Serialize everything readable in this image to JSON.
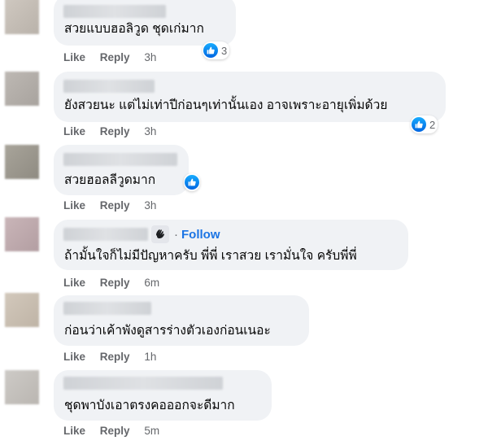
{
  "actions": {
    "like": "Like",
    "reply": "Reply"
  },
  "colors": {
    "bubble": "#f0f2f5",
    "link": "#1b74e4",
    "muted": "#65676b",
    "like_blue": "#0866ff"
  },
  "comments": [
    {
      "text": "สวยแบบฮอลิวูด ชุดเก่มาก",
      "time": "3h",
      "reactions": "3"
    },
    {
      "text": "ยังสวยนะ แต่ไม่เท่าปีก่อนๆเท่านั้นเอง อาจเพราะอายุเพิ่มด้วย",
      "time": "3h",
      "reactions": "2"
    },
    {
      "text": "สวยฮอลลีวูดมาก",
      "time": "3h",
      "reactions": ""
    },
    {
      "text": "ถ้ามั้นใจก็ไม่มีปัญหาครับ พี่พี่ เราสวย เรามั่นใจ ครับพี่พี่",
      "time": "6m",
      "follow": "Follow"
    },
    {
      "text": "ก่อนว่าเค้าพังดูสารร่างตัวเองก่อนเนอะ",
      "time": "1h"
    },
    {
      "text": "ชุดพาบังเอาตรงคอออกจะดีมาก",
      "time": "5m"
    }
  ]
}
